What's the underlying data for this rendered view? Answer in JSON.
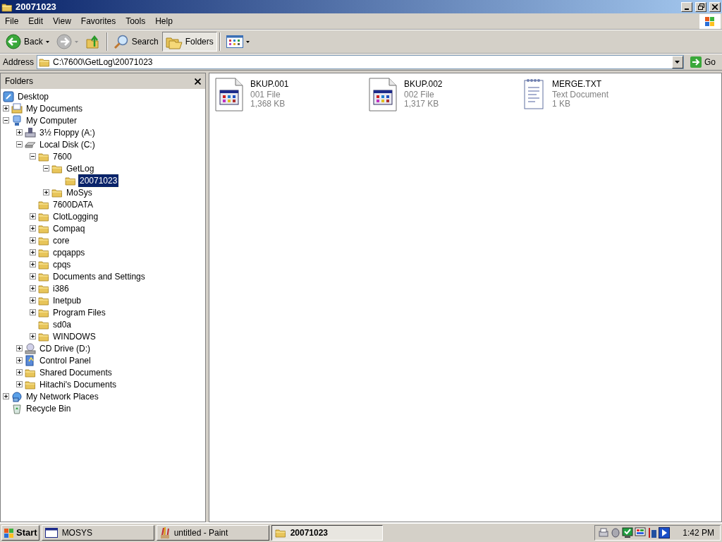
{
  "window": {
    "title": "20071023"
  },
  "menu": [
    "File",
    "Edit",
    "View",
    "Favorites",
    "Tools",
    "Help"
  ],
  "toolbar": {
    "back": {
      "label": "Back",
      "disabled": false
    },
    "forward": {
      "disabled": true
    },
    "search": {
      "label": "Search"
    },
    "folders": {
      "label": "Folders",
      "pressed": true
    }
  },
  "address": {
    "label": "Address",
    "value": "C:\\7600\\GetLog\\20071023",
    "go": "Go"
  },
  "folders_pane": {
    "title": "Folders",
    "tree": [
      {
        "label": "Desktop",
        "kind": "desktop",
        "expandable": false,
        "selected": false,
        "children": [
          {
            "label": "My Documents",
            "kind": "documents",
            "expandable": true,
            "expanded": false,
            "selected": false
          },
          {
            "label": "My Computer",
            "kind": "computer",
            "expandable": true,
            "expanded": true,
            "selected": false,
            "children": [
              {
                "label": "3½ Floppy (A:)",
                "kind": "floppy",
                "expandable": true,
                "expanded": false,
                "selected": false
              },
              {
                "label": "Local Disk (C:)",
                "kind": "disk",
                "expandable": true,
                "expanded": true,
                "selected": false,
                "children": [
                  {
                    "label": "7600",
                    "kind": "folder",
                    "expandable": true,
                    "expanded": true,
                    "selected": false,
                    "children": [
                      {
                        "label": "GetLog",
                        "kind": "folder",
                        "expandable": true,
                        "expanded": true,
                        "selected": false,
                        "children": [
                          {
                            "label": "20071023",
                            "kind": "folder",
                            "expandable": false,
                            "selected": true
                          }
                        ]
                      },
                      {
                        "label": "MoSys",
                        "kind": "folder",
                        "expandable": true,
                        "expanded": false,
                        "selected": false
                      }
                    ]
                  },
                  {
                    "label": "7600DATA",
                    "kind": "folder",
                    "expandable": false,
                    "selected": false
                  },
                  {
                    "label": "ClotLogging",
                    "kind": "folder",
                    "expandable": true,
                    "expanded": false,
                    "selected": false
                  },
                  {
                    "label": "Compaq",
                    "kind": "folder",
                    "expandable": true,
                    "expanded": false,
                    "selected": false
                  },
                  {
                    "label": "core",
                    "kind": "folder",
                    "expandable": true,
                    "expanded": false,
                    "selected": false
                  },
                  {
                    "label": "cpqapps",
                    "kind": "folder",
                    "expandable": true,
                    "expanded": false,
                    "selected": false
                  },
                  {
                    "label": "cpqs",
                    "kind": "folder",
                    "expandable": true,
                    "expanded": false,
                    "selected": false
                  },
                  {
                    "label": "Documents and Settings",
                    "kind": "folder",
                    "expandable": true,
                    "expanded": false,
                    "selected": false
                  },
                  {
                    "label": "i386",
                    "kind": "folder",
                    "expandable": true,
                    "expanded": false,
                    "selected": false
                  },
                  {
                    "label": "Inetpub",
                    "kind": "folder",
                    "expandable": true,
                    "expanded": false,
                    "selected": false
                  },
                  {
                    "label": "Program Files",
                    "kind": "folder",
                    "expandable": true,
                    "expanded": false,
                    "selected": false
                  },
                  {
                    "label": "sd0a",
                    "kind": "folder",
                    "expandable": false,
                    "selected": false
                  },
                  {
                    "label": "WINDOWS",
                    "kind": "folder",
                    "expandable": true,
                    "expanded": false,
                    "selected": false
                  }
                ]
              },
              {
                "label": "CD Drive (D:)",
                "kind": "cd",
                "expandable": true,
                "expanded": false,
                "selected": false
              },
              {
                "label": "Control Panel",
                "kind": "control",
                "expandable": true,
                "expanded": false,
                "selected": false
              },
              {
                "label": "Shared Documents",
                "kind": "folder",
                "expandable": true,
                "expanded": false,
                "selected": false
              },
              {
                "label": "Hitachi's Documents",
                "kind": "folder",
                "expandable": true,
                "expanded": false,
                "selected": false
              }
            ]
          },
          {
            "label": "My Network Places",
            "kind": "network",
            "expandable": true,
            "expanded": false,
            "selected": false
          },
          {
            "label": "Recycle Bin",
            "kind": "recycle",
            "expandable": false,
            "selected": false
          }
        ]
      }
    ]
  },
  "files": [
    {
      "name": "BKUP.001",
      "type": "001 File",
      "size": "1,368 KB",
      "kind": "app"
    },
    {
      "name": "BKUP.002",
      "type": "002 File",
      "size": "1,317 KB",
      "kind": "app"
    },
    {
      "name": "MERGE.TXT",
      "type": "Text Document",
      "size": "1 KB",
      "kind": "text"
    }
  ],
  "taskbar": {
    "start": "Start",
    "tasks": [
      {
        "label": "MOSYS",
        "kind": "window",
        "selected": false
      },
      {
        "label": "untitled - Paint",
        "kind": "paint",
        "selected": false
      },
      {
        "label": "20071023",
        "kind": "folder",
        "selected": true
      }
    ],
    "clock": "1:42 PM"
  }
}
